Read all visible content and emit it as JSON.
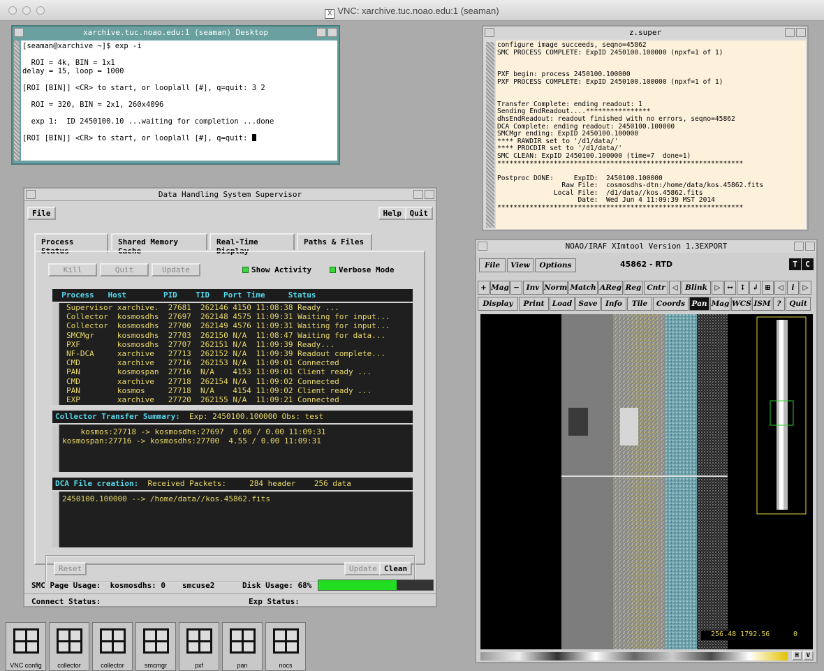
{
  "mac": {
    "title": "VNC: xarchive.tuc.noao.edu:1 (seaman)"
  },
  "desktop_term": {
    "title": "xarchive.tuc.noao.edu:1 (seaman) Desktop",
    "lines": [
      "[seaman@xarchive ~]$ exp -i",
      "",
      "  ROI = 4k, BIN = 1x1",
      "delay = 15, loop = 1000",
      "",
      "[ROI [BIN]] <CR> to start, or looplall [#], q=quit: 3 2",
      "",
      "  ROI = 320, BIN = 2x1, 260x4096",
      "",
      "  exp 1:  ID 2450100.10 ...waiting for completion ...done",
      "",
      "[ROI [BIN]] <CR> to start, or looplall [#], q=quit: "
    ]
  },
  "zsuper": {
    "title": "z.super",
    "lines": [
      "configure image succeeds, seqno=45862",
      "SMC PROCESS COMPLETE: ExpID 2450100.100000 (npxf=1 of 1)",
      "",
      "",
      "PXF begin: process 2450100.100000",
      "PXF PROCESS COMPLETE: ExpID 2450100.100000 (npxf=1 of 1)",
      "",
      "",
      "Transfer Complete: ending readout: 1",
      "Sending EndReadout....****************",
      "dhsEndReadout: readout finished with no errors, seqno=45862",
      "DCA Complete: ending readout: 2450100.100000",
      "SMCMgr ending: ExpID 2450100.100000",
      "**** RAWDIR set to '/d1/data/'",
      "**** PROCDIR set to '/d1/data/'",
      "SMC CLEAN: ExpID 2450100.100000 (time=7  done=1)",
      "*************************************************************",
      "",
      "Postproc DONE:     ExpID:  2450100.100000",
      "                Raw File:  cosmosdhs-dtn:/home/data/kos.45862.fits",
      "              Local File:  /d1/data//kos.45862.fits",
      "                    Date:  Wed Jun 4 11:09:39 MST 2014",
      "*************************************************************",
      "",
      "",
      "",
      "",
      ""
    ]
  },
  "dhs": {
    "title": "Data Handling System Supervisor",
    "file": "File",
    "help": "Help",
    "quit": "Quit",
    "tabs": [
      "Process Status",
      "Shared Memory Cache",
      "Real-Time Display",
      "Paths & Files"
    ],
    "kill": "Kill",
    "quit_btn": "Quit",
    "update": "Update",
    "show_activity": "Show Activity",
    "verbose": "Verbose Mode",
    "proc_header": "  Process   Host        PID    TID   Port Time     Status",
    "processes": [
      "Supervisor xarchive.  27681  262146 4150 11:08:38 Ready ...",
      "Collector  kosmosdhs  27697  262148 4575 11:09:31 Waiting for input...",
      "Collector  kosmosdhs  27700  262149 4576 11:09:31 Waiting for input...",
      "SMCMgr     kosmosdhs  27703  262150 N/A  11:08:47 Waiting for data...",
      "PXF        kosmosdhs  27707  262151 N/A  11:09:39 Ready...",
      "NF-DCA     xarchive   27713  262152 N/A  11:09:39 Readout complete...",
      "CMD        xarchive   27716  262153 N/A  11:09:01 Connected",
      "PAN        kosmospan  27716  N/A    4153 11:09:01 Client ready ...",
      "CMD        xarchive   27718  262154 N/A  11:09:02 Connected",
      "PAN        kosmos     27718  N/A    4154 11:09:02 Client ready ...",
      "EXP        xarchive   27720  262155 N/A  11:09:21 Connected"
    ],
    "collector_header": "Collector Transfer Summary:",
    "collector_info": "  Exp: 2450100.100000 Obs: test",
    "collector_lines": [
      "    kosmos:27718 -> kosmosdhs:27697  0.06 / 0.00 11:09:31",
      "kosmospan:27716 -> kosmosdhs:27700  4.55 / 0.00 11:09:31"
    ],
    "dca_header": "DCA File creation:",
    "dca_info": "  Received Packets:     284 header    256 data",
    "dca_lines": [
      "2450100.100000 --> /home/data//kos.45862.fits"
    ],
    "reset": "Reset",
    "update2": "Update",
    "clean": "Clean",
    "smc_label": "SMC Page Usage:  kosmosdhs: 0",
    "smc_host": "smcuse2",
    "disk_label": "Disk Usage: 68%",
    "disk_fraction": 0.68,
    "connect": "Connect Status:",
    "exp": "Exp Status:"
  },
  "ximtool": {
    "title": "NOAO/IRAF XImtool Version 1.3EXPORT",
    "frame": "45862 - RTD",
    "menu": [
      "File",
      "View",
      "Options"
    ],
    "row1": [
      "+",
      "Mag",
      "−",
      "Inv",
      "Norm",
      "Match",
      "AReg",
      "Reg",
      "Cntr",
      "◁",
      "Blink",
      "▷",
      "↔",
      "↕",
      "↲",
      "⊞",
      "◁",
      "i",
      "▷"
    ],
    "row2": [
      "Display",
      "Print",
      "Load",
      "Save",
      "Info",
      "Tile",
      "Coords",
      "Pan",
      "Mag",
      "WCS",
      "ISM",
      "?",
      "Quit"
    ],
    "coords": "256.48 1792.56",
    "value": "0",
    "h": "H",
    "v": "V"
  },
  "icons": [
    "VNC config",
    "collector",
    "collector",
    "smcmgr",
    "pxf",
    "pan",
    "nocs"
  ]
}
